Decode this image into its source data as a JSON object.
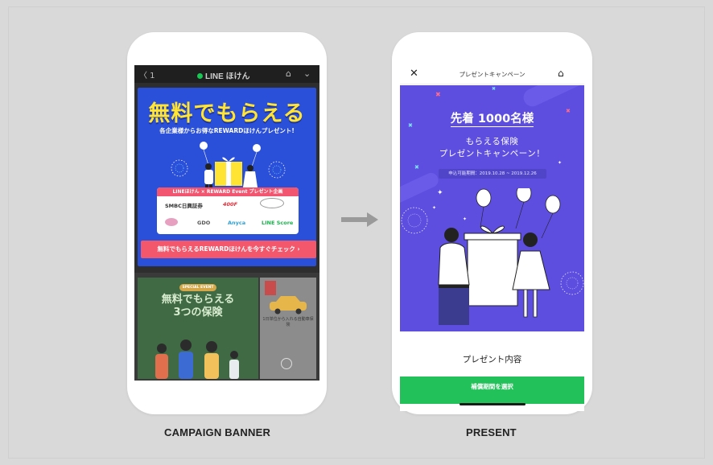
{
  "captions": {
    "left": "CAMPAIGN BANNER",
    "right": "PRESENT"
  },
  "left_phone": {
    "header": {
      "back": "〈 1",
      "title": "LINE ほけん",
      "home_icon": "home-icon",
      "chevron_icon": "chevron-down-icon"
    },
    "banner": {
      "headline": "無料でもらえる",
      "subhead": "各企業様からお得なREWARDほけんプレゼント!",
      "partner_title": "LINEほけん × REWARD Event プレゼント企画",
      "logos": [
        "SMBC日興証券",
        "400F",
        "",
        "",
        "GDO",
        "Anyca",
        "LINE Score"
      ],
      "cta": "無料でもらえるREWARDほけんを今すぐチェック ›",
      "colors": {
        "background": "#2a4fd8",
        "headline": "#ffe433",
        "cta": "#f3576c"
      }
    },
    "lower": {
      "special_badge": "SPECIAL EVENT",
      "card1_title_line1": "無料でもらえる",
      "card1_title_line2": "3つの保険",
      "card2_text": "1日単位から入れる自動車保険"
    }
  },
  "right_phone": {
    "header": {
      "close_icon": "close-icon",
      "title": "プレゼントキャンペーン",
      "home_icon": "home-icon"
    },
    "hero": {
      "first_come": "先着 1000名様",
      "sub_line1": "もらえる保険",
      "sub_line2": "プレゼントキャンペーン！",
      "period": "申込可能期間：2019.10.28 ~ 2019.12.26",
      "colors": {
        "background": "#5d4ee0"
      }
    },
    "present_heading": "プレゼント内容",
    "button": "補償期間を選択",
    "colors": {
      "button": "#23c15a"
    }
  },
  "arrow_icon": "arrow-right-icon"
}
